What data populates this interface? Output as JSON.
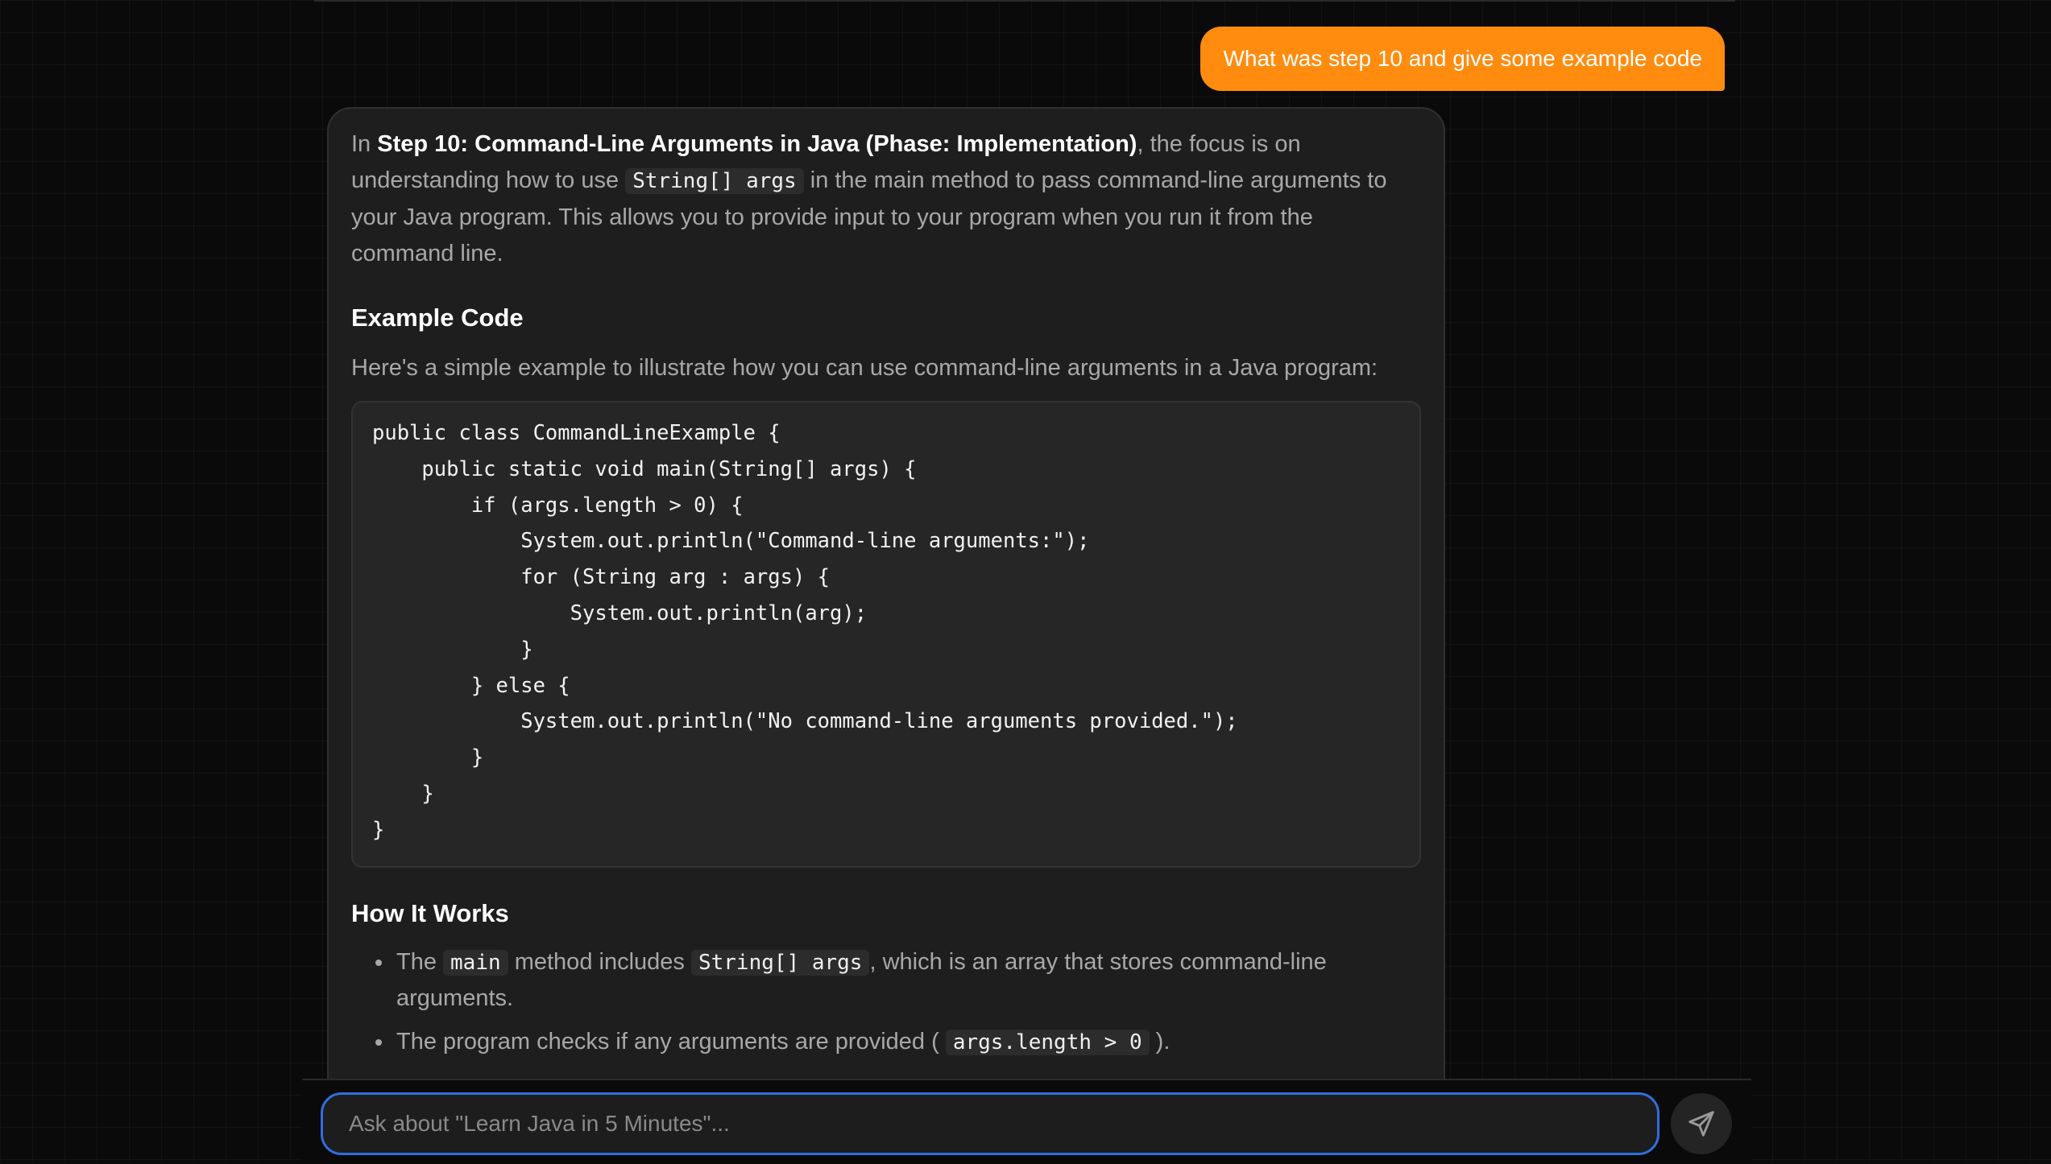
{
  "conversation": {
    "user_message": "What was step 10 and give some example code",
    "assistant": {
      "intro_prefix": "In ",
      "intro_bold": "Step 10: Command-Line Arguments in Java (Phase: Implementation)",
      "intro_mid": ", the focus is on understanding how to use ",
      "intro_code": "String[] args",
      "intro_suffix": " in the main method to pass command-line arguments to your Java program. This allows you to provide input to your program when you run it from the command line.",
      "example_heading": "Example Code",
      "example_intro": "Here's a simple example to illustrate how you can use command-line arguments in a Java program:",
      "code_lines": [
        "public class CommandLineExample {",
        "    public static void main(String[] args) {",
        "        if (args.length > 0) {",
        "            System.out.println(\"Command-line arguments:\");",
        "            for (String arg : args) {",
        "                System.out.println(arg);",
        "            }",
        "        } else {",
        "            System.out.println(\"No command-line arguments provided.\");",
        "        }",
        "    }",
        "}"
      ],
      "how_heading": "How It Works",
      "bullet1": {
        "prefix": "The ",
        "code1": "main",
        "mid": " method includes ",
        "code2": "String[] args",
        "suffix": ", which is an array that stores command-line arguments."
      },
      "bullet2": {
        "prefix": "The program checks if any arguments are provided ( ",
        "code": "args.length > 0",
        "suffix": " )."
      }
    }
  },
  "input": {
    "placeholder": "Ask about \"Learn Java in 5 Minutes\"..."
  },
  "icons": {
    "send": "send-icon"
  },
  "colors": {
    "accent": "#ff8c0f",
    "input_focus": "#2f6fe0",
    "background": "#0a0a0a",
    "card": "#1e1e1e"
  }
}
